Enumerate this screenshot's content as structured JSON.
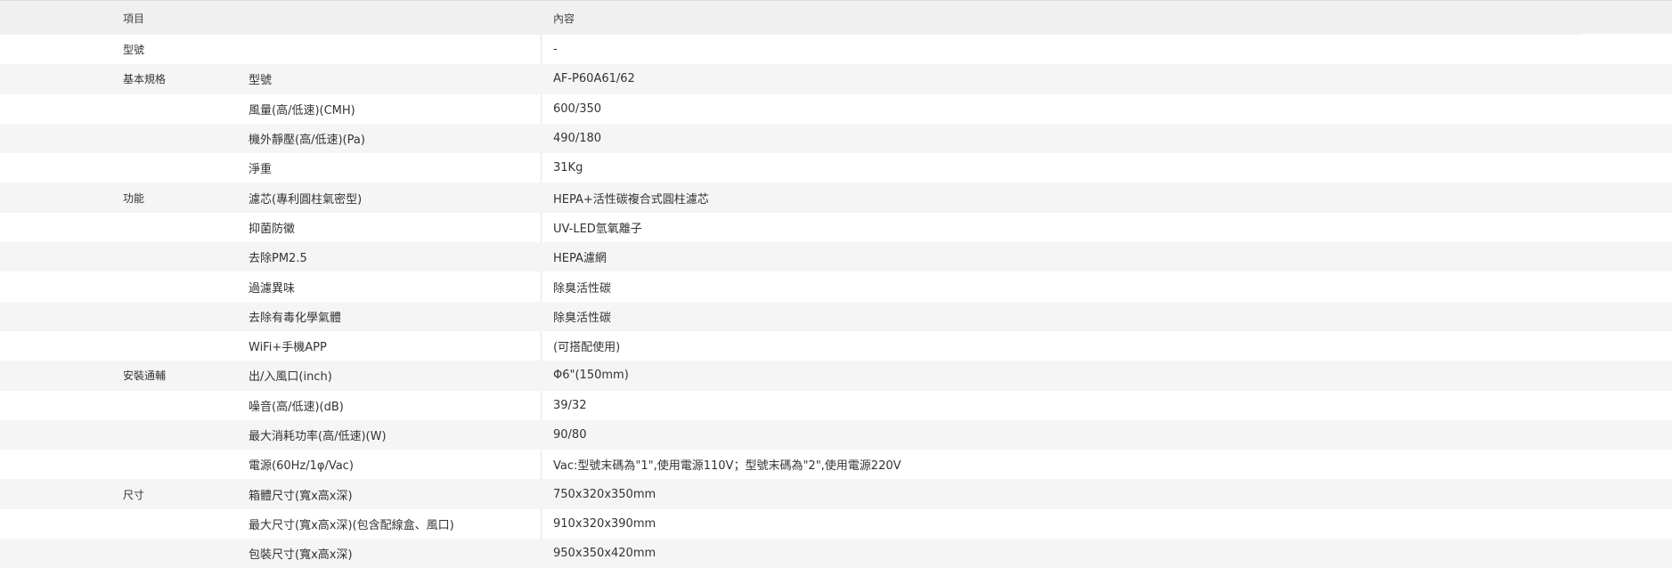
{
  "header": {
    "col_item": "項目",
    "col_content": "內容"
  },
  "rows": [
    {
      "category": "型號",
      "item": "",
      "value": "-"
    },
    {
      "category": "基本規格",
      "item": "型號",
      "value": "AF-P60A61/62"
    },
    {
      "category": "",
      "item": "風量(高/低速)(CMH)",
      "value": "600/350"
    },
    {
      "category": "",
      "item": "機外靜壓(高/低速)(Pa)",
      "value": "490/180"
    },
    {
      "category": "",
      "item": "淨重",
      "value": "31Kg"
    },
    {
      "category": "功能",
      "item": "濾芯(專利圓柱氣密型)",
      "value": "HEPA+活性碳複合式圓柱濾芯"
    },
    {
      "category": "",
      "item": "抑菌防黴",
      "value": "UV-LED氫氧離子"
    },
    {
      "category": "",
      "item": "去除PM2.5",
      "value": "HEPA濾網"
    },
    {
      "category": "",
      "item": "過濾異味",
      "value": "除臭活性碳"
    },
    {
      "category": "",
      "item": "去除有毒化學氣體",
      "value": "除臭活性碳"
    },
    {
      "category": "",
      "item": "WiFi+手機APP",
      "value": "(可搭配使用)"
    },
    {
      "category": "安裝通輔",
      "item": "出/入風口(inch)",
      "value": "Φ6\"(150mm)"
    },
    {
      "category": "",
      "item": "噪音(高/低速)(dB)",
      "value": "39/32"
    },
    {
      "category": "",
      "item": "最大消耗功率(高/低速)(W)",
      "value": "90/80"
    },
    {
      "category": "",
      "item": "電源(60Hz/1φ/Vac)",
      "value": "Vac:型號末碼為\"1\",使用電源110V；型號末碼為\"2\",使用電源220V"
    },
    {
      "category": "尺寸",
      "item": "箱體尺寸(寬x高x深)",
      "value": "750x320x350mm"
    },
    {
      "category": "",
      "item": "最大尺寸(寬x高x深)(包含配線盒、風口)",
      "value": "910x320x390mm"
    },
    {
      "category": "",
      "item": "包裝尺寸(寬x高x深)",
      "value": "950x350x420mm"
    }
  ]
}
